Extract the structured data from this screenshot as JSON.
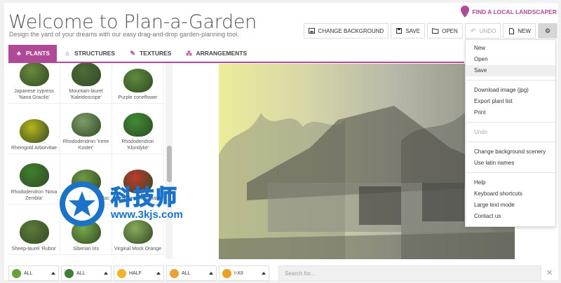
{
  "header": {
    "title": "Welcome to Plan-a-Garden",
    "subtitle": "Design the yard of your dreams with our easy drag-and-drop garden-planning tool.",
    "landscaper_link": "FIND A LOCAL LANDSCAPER"
  },
  "toolbar": {
    "change_background": "CHANGE BACKGROUND",
    "save": "SAVE",
    "open": "OPEN",
    "undo": "UNDO",
    "new": "NEW"
  },
  "tabs": [
    {
      "label": "PLANTS",
      "icon": "plant-icon",
      "active": true
    },
    {
      "label": "STRUCTURES",
      "icon": "house-icon",
      "active": false
    },
    {
      "label": "TEXTURES",
      "icon": "paint-icon",
      "active": false
    },
    {
      "label": "ARRANGEMENTS",
      "icon": "arrangement-icon",
      "active": false
    }
  ],
  "plants": [
    {
      "name": "Japanese cypress 'Nana Gracilis'",
      "color": "#6a8a3c"
    },
    {
      "name": "Mountain-laurel 'Kaleidoscope'",
      "color": "#4e6b3a"
    },
    {
      "name": "Purple coneflower",
      "color": "#5f8a3f"
    },
    {
      "name": "Rheingold Arborvitae",
      "color": "#b8b41c"
    },
    {
      "name": "Rhododendron 'Irene Koster'",
      "color": "#7e9c6a"
    },
    {
      "name": "Rhododendron 'Klondyke'",
      "color": "#3f8a35"
    },
    {
      "name": "Rhododendron 'Nova Zembla'",
      "color": "#3f7f2f"
    },
    {
      "name": "Dwarf Flowering Lilac",
      "color": "#6f9a45"
    },
    {
      "name": "Red Flowering Plant",
      "color": "#c0392b"
    },
    {
      "name": "Sheep-laurel 'Rubra'",
      "color": "#5f7a3a"
    },
    {
      "name": "Siberian Iris",
      "color": "#78a84a"
    },
    {
      "name": "Virginal Mock Orange",
      "color": "#8aaa5e"
    }
  ],
  "filters": [
    {
      "value": "ALL",
      "icon": "tree-icon",
      "color": "#6aa13a"
    },
    {
      "value": "ALL",
      "icon": "shrub-icon",
      "color": "#3f7f35"
    },
    {
      "value": "HALF",
      "icon": "sun-icon",
      "color": "#f0b429"
    },
    {
      "value": "ALL",
      "icon": "water-icon",
      "color": "#e8a23a"
    },
    {
      "value": "I-XII",
      "icon": "flower-icon",
      "color": "#f0a020"
    }
  ],
  "search": {
    "placeholder": "Search for..."
  },
  "menu": {
    "items": [
      {
        "label": "New"
      },
      {
        "label": "Open"
      },
      {
        "label": "Save",
        "highlighted": true
      },
      {
        "separator": true
      },
      {
        "label": "Download image (jpg)"
      },
      {
        "label": "Export plant list"
      },
      {
        "label": "Print"
      },
      {
        "separator": true
      },
      {
        "label": "Undo",
        "disabled": true
      },
      {
        "separator": true
      },
      {
        "label": "Change background scenery"
      },
      {
        "label": "Use latin names"
      },
      {
        "separator": true
      },
      {
        "label": "Help"
      },
      {
        "label": "Keyboard shortcuts"
      },
      {
        "label": "Large text mode"
      },
      {
        "label": "Contact us"
      }
    ]
  },
  "watermark": {
    "big": "科技师",
    "small": "www.3kjs.com"
  },
  "colors": {
    "accent": "#b04a96",
    "watermark": "#1a73c8"
  }
}
